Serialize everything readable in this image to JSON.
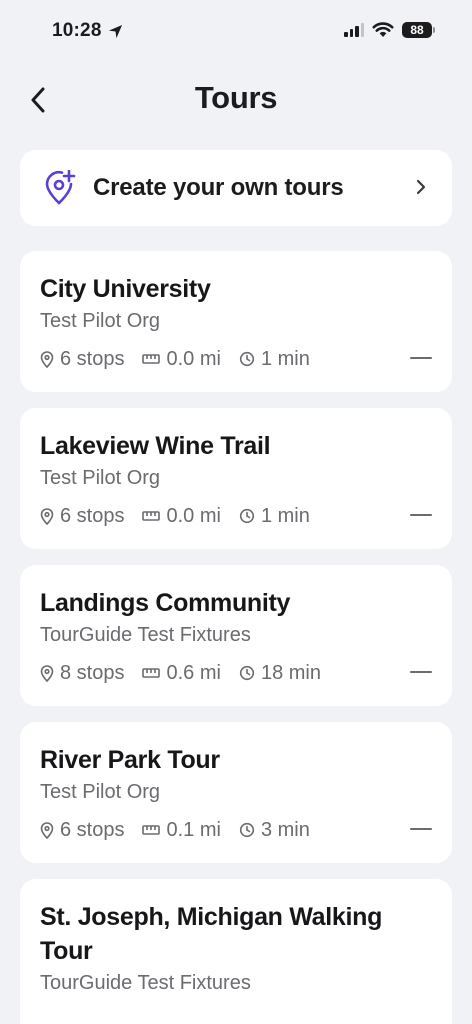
{
  "status_bar": {
    "time": "10:28",
    "battery": "88"
  },
  "nav": {
    "title": "Tours"
  },
  "create_card": {
    "label": "Create your own tours",
    "icon": "map-pin-plus-icon",
    "accent_color": "#5b3fd6"
  },
  "tours": [
    {
      "title": "City University",
      "org": "Test Pilot Org",
      "stops": "6 stops",
      "distance": "0.0 mi",
      "duration": "1 min"
    },
    {
      "title": "Lakeview Wine Trail",
      "org": "Test Pilot Org",
      "stops": "6 stops",
      "distance": "0.0 mi",
      "duration": "1 min"
    },
    {
      "title": "Landings Community",
      "org": "TourGuide Test Fixtures",
      "stops": "8 stops",
      "distance": "0.6 mi",
      "duration": "18 min"
    },
    {
      "title": "River Park Tour",
      "org": "Test Pilot Org",
      "stops": "6 stops",
      "distance": "0.1 mi",
      "duration": "3 min"
    },
    {
      "title": "St. Joseph, Michigan Walking Tour",
      "org": "TourGuide Test Fixtures",
      "stops": "",
      "distance": "",
      "duration": ""
    }
  ]
}
